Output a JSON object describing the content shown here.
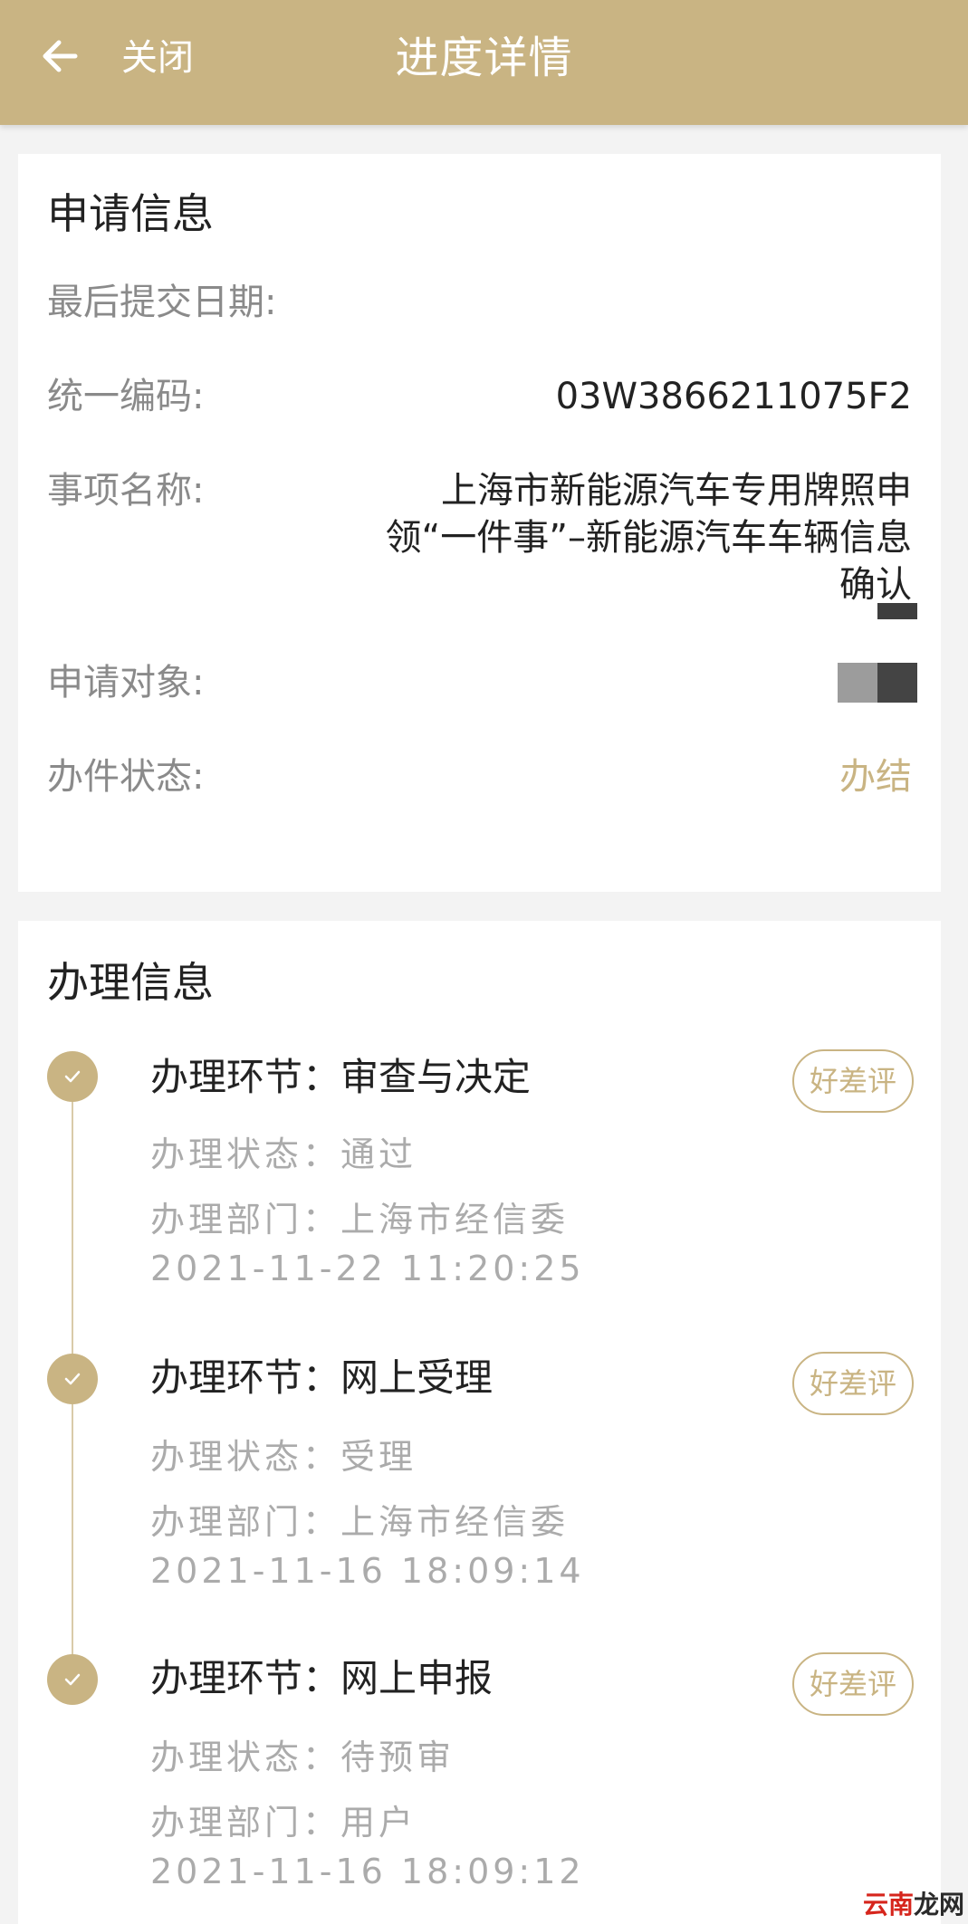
{
  "header": {
    "close_label": "关闭",
    "title": "进度详情",
    "bg_color": "#c9b483"
  },
  "apply_info": {
    "title": "申请信息",
    "fields": [
      {
        "label": "最后提交日期:",
        "value": ""
      },
      {
        "label": "统一编码:",
        "value": "03W3866211075F2"
      },
      {
        "label": "事项名称:",
        "value": "上海市新能源汽车专用牌照申领“一件事”–新能源汽车车辆信息确认"
      },
      {
        "label": "申请对象:",
        "value": ""
      },
      {
        "label": "办件状态:",
        "value": "办结"
      }
    ]
  },
  "process_info": {
    "title": "办理信息",
    "rate_label": "好差评",
    "steps": [
      {
        "title": "办理环节：审查与决定",
        "status": "办理状态：通过",
        "dept": "办理部门：上海市经信委",
        "time": "2021-11-22 11:20:25"
      },
      {
        "title": "办理环节：网上受理",
        "status": "办理状态：受理",
        "dept": "办理部门：上海市经信委",
        "time": "2021-11-16 18:09:14"
      },
      {
        "title": "办理环节：网上申报",
        "status": "办理状态：待预审",
        "dept": "办理部门：用户",
        "time": "2021-11-16 18:09:12"
      }
    ]
  },
  "watermark": {
    "part_a": "云南",
    "part_b": "龙网"
  },
  "icons": {
    "back": "arrow-left-icon",
    "step": "check-icon"
  },
  "colors": {
    "accent": "#c9b483",
    "label": "#8a8a8a",
    "muted": "#ababab",
    "text": "#222222"
  }
}
